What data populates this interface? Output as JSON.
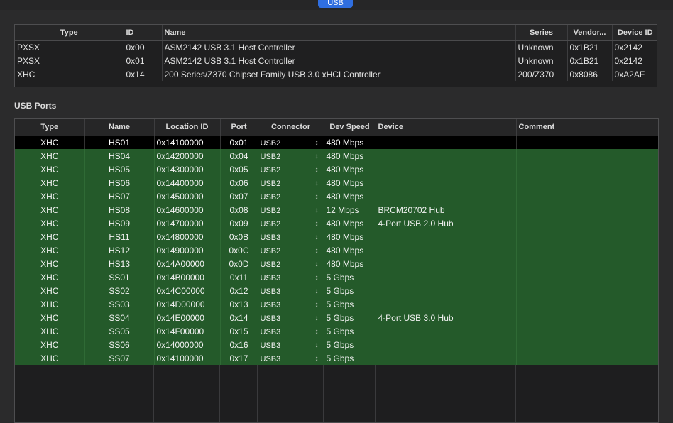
{
  "tab": {
    "label": "USB"
  },
  "controllers": {
    "columns": [
      "Type",
      "ID",
      "Name",
      "Series",
      "Vendor...",
      "Device ID"
    ],
    "rows": [
      {
        "type": "PXSX",
        "id": "0x00",
        "name": "ASM2142 USB 3.1 Host Controller",
        "series": "Unknown",
        "vendor": "0x1B21",
        "device_id": "0x2142"
      },
      {
        "type": "PXSX",
        "id": "0x01",
        "name": "ASM2142 USB 3.1 Host Controller",
        "series": "Unknown",
        "vendor": "0x1B21",
        "device_id": "0x2142"
      },
      {
        "type": "XHC",
        "id": "0x14",
        "name": "200 Series/Z370 Chipset Family USB 3.0 xHCI Controller",
        "series": "200/Z370",
        "vendor": "0x8086",
        "device_id": "0xA2AF"
      }
    ]
  },
  "ports_section": {
    "title": "USB Ports"
  },
  "ports": {
    "columns": [
      "Type",
      "Name",
      "Location ID",
      "Port",
      "Connector",
      "Dev Speed",
      "Device",
      "Comment"
    ],
    "rows": [
      {
        "type": "XHC",
        "name": "HS01",
        "location": "0x14100000",
        "port": "0x01",
        "connector": "USB2",
        "speed": "480 Mbps",
        "device": "",
        "comment": ""
      },
      {
        "type": "XHC",
        "name": "HS04",
        "location": "0x14200000",
        "port": "0x04",
        "connector": "USB2",
        "speed": "480 Mbps",
        "device": "",
        "comment": ""
      },
      {
        "type": "XHC",
        "name": "HS05",
        "location": "0x14300000",
        "port": "0x05",
        "connector": "USB2",
        "speed": "480 Mbps",
        "device": "",
        "comment": ""
      },
      {
        "type": "XHC",
        "name": "HS06",
        "location": "0x14400000",
        "port": "0x06",
        "connector": "USB2",
        "speed": "480 Mbps",
        "device": "",
        "comment": ""
      },
      {
        "type": "XHC",
        "name": "HS07",
        "location": "0x14500000",
        "port": "0x07",
        "connector": "USB2",
        "speed": "480 Mbps",
        "device": "",
        "comment": ""
      },
      {
        "type": "XHC",
        "name": "HS08",
        "location": "0x14600000",
        "port": "0x08",
        "connector": "USB2",
        "speed": "12 Mbps",
        "device": "BRCM20702 Hub",
        "comment": ""
      },
      {
        "type": "XHC",
        "name": "HS09",
        "location": "0x14700000",
        "port": "0x09",
        "connector": "USB2",
        "speed": "480 Mbps",
        "device": "4-Port USB 2.0 Hub",
        "comment": ""
      },
      {
        "type": "XHC",
        "name": "HS11",
        "location": "0x14800000",
        "port": "0x0B",
        "connector": "USB3",
        "speed": "480 Mbps",
        "device": "",
        "comment": ""
      },
      {
        "type": "XHC",
        "name": "HS12",
        "location": "0x14900000",
        "port": "0x0C",
        "connector": "USB2",
        "speed": "480 Mbps",
        "device": "",
        "comment": ""
      },
      {
        "type": "XHC",
        "name": "HS13",
        "location": "0x14A00000",
        "port": "0x0D",
        "connector": "USB2",
        "speed": "480 Mbps",
        "device": "",
        "comment": ""
      },
      {
        "type": "XHC",
        "name": "SS01",
        "location": "0x14B00000",
        "port": "0x11",
        "connector": "USB3",
        "speed": "5 Gbps",
        "device": "",
        "comment": ""
      },
      {
        "type": "XHC",
        "name": "SS02",
        "location": "0x14C00000",
        "port": "0x12",
        "connector": "USB3",
        "speed": "5 Gbps",
        "device": "",
        "comment": ""
      },
      {
        "type": "XHC",
        "name": "SS03",
        "location": "0x14D00000",
        "port": "0x13",
        "connector": "USB3",
        "speed": "5 Gbps",
        "device": "",
        "comment": ""
      },
      {
        "type": "XHC",
        "name": "SS04",
        "location": "0x14E00000",
        "port": "0x14",
        "connector": "USB3",
        "speed": "5 Gbps",
        "device": "4-Port USB 3.0 Hub",
        "comment": ""
      },
      {
        "type": "XHC",
        "name": "SS05",
        "location": "0x14F00000",
        "port": "0x15",
        "connector": "USB3",
        "speed": "5 Gbps",
        "device": "",
        "comment": ""
      },
      {
        "type": "XHC",
        "name": "SS06",
        "location": "0x14000000",
        "port": "0x16",
        "connector": "USB3",
        "speed": "5 Gbps",
        "device": "",
        "comment": ""
      },
      {
        "type": "XHC",
        "name": "SS07",
        "location": "0x14100000",
        "port": "0x17",
        "connector": "USB3",
        "speed": "5 Gbps",
        "device": "",
        "comment": ""
      }
    ]
  },
  "colors": {
    "row_green": "#245a2a",
    "selected": "#000000",
    "tab_blue": "#2f6ee0"
  },
  "icons": {
    "connector_stepper": "up-down-chevron-icon"
  }
}
